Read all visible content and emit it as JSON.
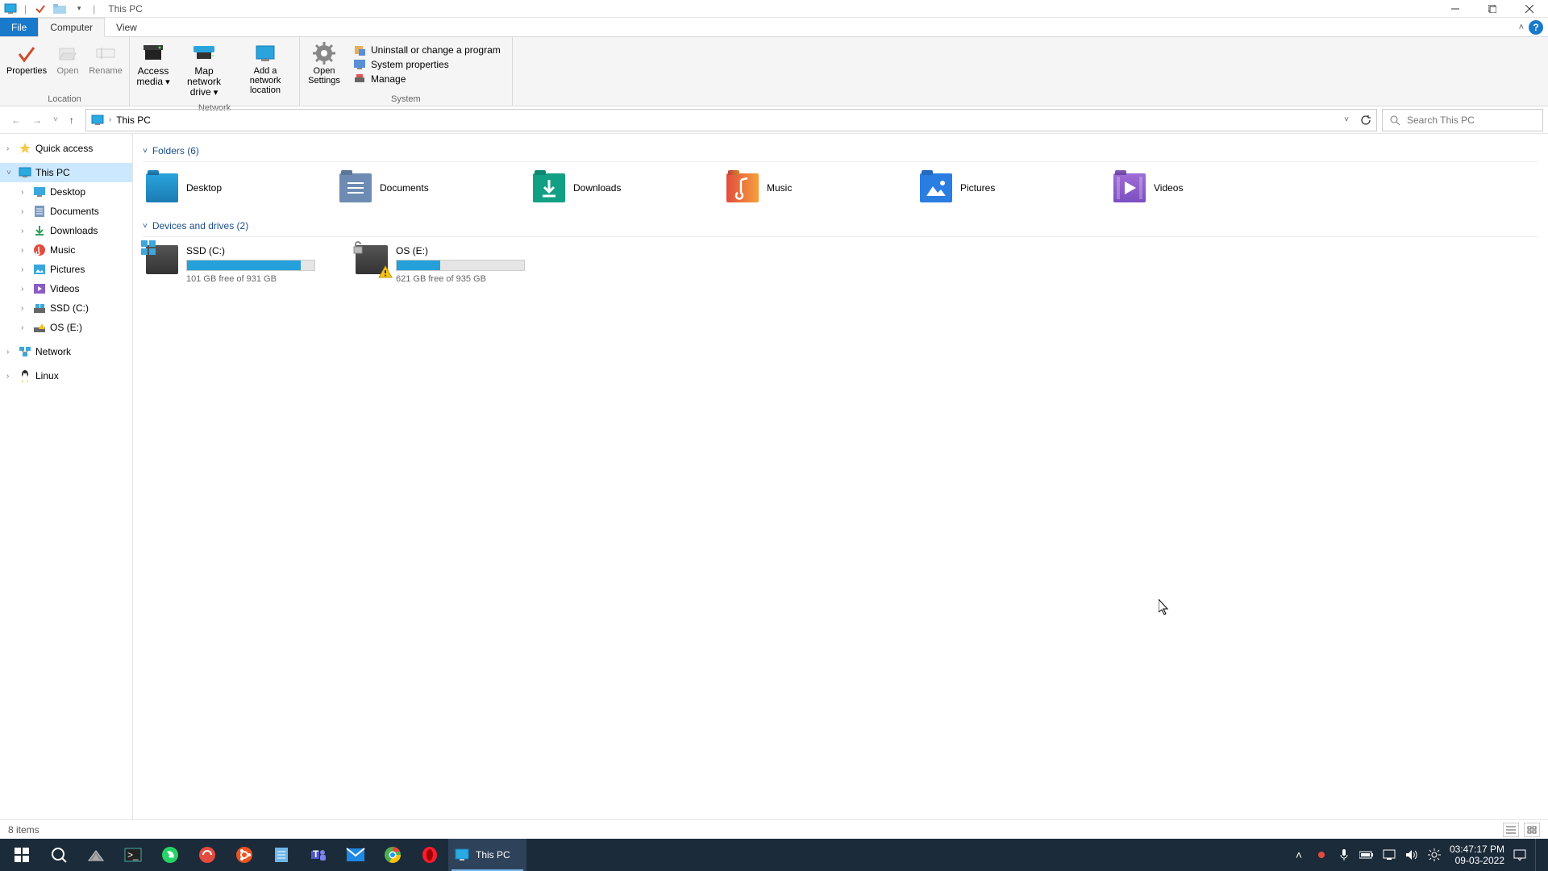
{
  "title": "This PC",
  "ribbon_tabs": {
    "file": "File",
    "computer": "Computer",
    "view": "View"
  },
  "ribbon": {
    "location": {
      "label": "Location",
      "properties": "Properties",
      "open": "Open",
      "rename": "Rename"
    },
    "network": {
      "label": "Network",
      "access_media": "Access media",
      "map_drive": "Map network drive",
      "add_location": "Add a network location"
    },
    "system": {
      "label": "System",
      "open_settings": "Open Settings",
      "uninstall": "Uninstall or change a program",
      "sysprops": "System properties",
      "manage": "Manage"
    }
  },
  "breadcrumb": {
    "root": "This PC"
  },
  "search_placeholder": "Search This PC",
  "nav": {
    "quick_access": "Quick access",
    "this_pc": "This PC",
    "desktop": "Desktop",
    "documents": "Documents",
    "downloads": "Downloads",
    "music": "Music",
    "pictures": "Pictures",
    "videos": "Videos",
    "ssd_c": "SSD (C:)",
    "os_e": "OS (E:)",
    "network": "Network",
    "linux": "Linux"
  },
  "sections": {
    "folders": "Folders (6)",
    "drives": "Devices and drives (2)"
  },
  "folders": {
    "desktop": "Desktop",
    "documents": "Documents",
    "downloads": "Downloads",
    "music": "Music",
    "pictures": "Pictures",
    "videos": "Videos"
  },
  "drives": {
    "c": {
      "name": "SSD (C:)",
      "free": "101 GB free of 931 GB",
      "fill_pct": 89
    },
    "e": {
      "name": "OS (E:)",
      "free": "621 GB free of 935 GB",
      "fill_pct": 34
    }
  },
  "status": {
    "items": "8 items"
  },
  "taskbar": {
    "this_pc": "This PC",
    "time": "03:47:17 PM",
    "date": "09-03-2022"
  }
}
